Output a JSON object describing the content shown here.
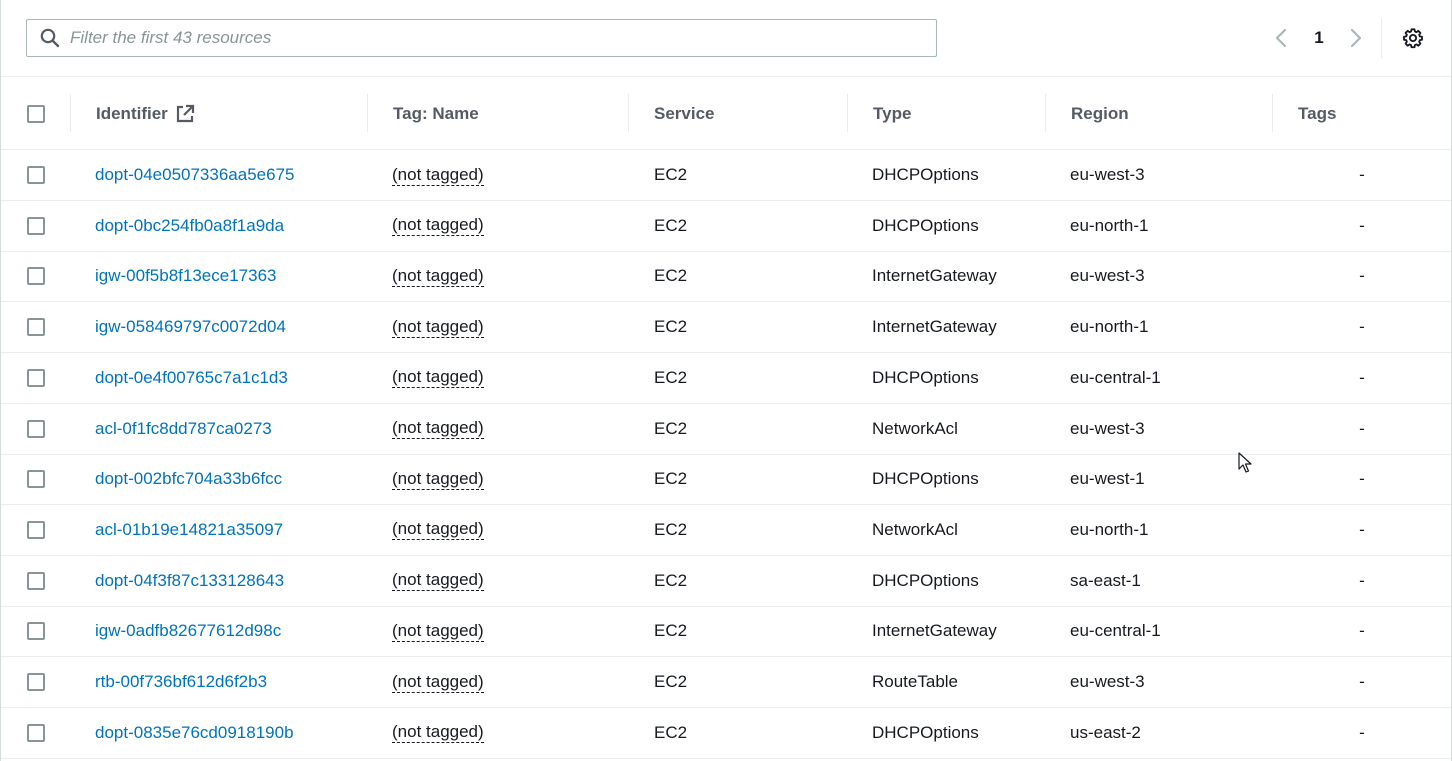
{
  "search": {
    "placeholder": "Filter the first 43 resources",
    "value": ""
  },
  "pagination": {
    "current_page": "1"
  },
  "table": {
    "columns": {
      "identifier": "Identifier",
      "tag_name": "Tag: Name",
      "service": "Service",
      "type": "Type",
      "region": "Region",
      "tags": "Tags"
    },
    "rows": [
      {
        "identifier": "dopt-04e0507336aa5e675",
        "tag_name": "(not tagged)",
        "service": "EC2",
        "type": "DHCPOptions",
        "region": "eu-west-3",
        "tags": "-"
      },
      {
        "identifier": "dopt-0bc254fb0a8f1a9da",
        "tag_name": "(not tagged)",
        "service": "EC2",
        "type": "DHCPOptions",
        "region": "eu-north-1",
        "tags": "-"
      },
      {
        "identifier": "igw-00f5b8f13ece17363",
        "tag_name": "(not tagged)",
        "service": "EC2",
        "type": "InternetGateway",
        "region": "eu-west-3",
        "tags": "-"
      },
      {
        "identifier": "igw-058469797c0072d04",
        "tag_name": "(not tagged)",
        "service": "EC2",
        "type": "InternetGateway",
        "region": "eu-north-1",
        "tags": "-"
      },
      {
        "identifier": "dopt-0e4f00765c7a1c1d3",
        "tag_name": "(not tagged)",
        "service": "EC2",
        "type": "DHCPOptions",
        "region": "eu-central-1",
        "tags": "-"
      },
      {
        "identifier": "acl-0f1fc8dd787ca0273",
        "tag_name": "(not tagged)",
        "service": "EC2",
        "type": "NetworkAcl",
        "region": "eu-west-3",
        "tags": "-"
      },
      {
        "identifier": "dopt-002bfc704a33b6fcc",
        "tag_name": "(not tagged)",
        "service": "EC2",
        "type": "DHCPOptions",
        "region": "eu-west-1",
        "tags": "-"
      },
      {
        "identifier": "acl-01b19e14821a35097",
        "tag_name": "(not tagged)",
        "service": "EC2",
        "type": "NetworkAcl",
        "region": "eu-north-1",
        "tags": "-"
      },
      {
        "identifier": "dopt-04f3f87c133128643",
        "tag_name": "(not tagged)",
        "service": "EC2",
        "type": "DHCPOptions",
        "region": "sa-east-1",
        "tags": "-"
      },
      {
        "identifier": "igw-0adfb82677612d98c",
        "tag_name": "(not tagged)",
        "service": "EC2",
        "type": "InternetGateway",
        "region": "eu-central-1",
        "tags": "-"
      },
      {
        "identifier": "rtb-00f736bf612d6f2b3",
        "tag_name": "(not tagged)",
        "service": "EC2",
        "type": "RouteTable",
        "region": "eu-west-3",
        "tags": "-"
      },
      {
        "identifier": "dopt-0835e76cd0918190b",
        "tag_name": "(not tagged)",
        "service": "EC2",
        "type": "DHCPOptions",
        "region": "us-east-2",
        "tags": "-"
      }
    ]
  },
  "icons": {
    "search": "search-icon",
    "prev": "chevron-left-icon",
    "next": "chevron-right-icon",
    "settings": "gear-icon",
    "external": "external-link-icon"
  },
  "colors": {
    "link": "#0073bb",
    "text": "#16191f",
    "header_text": "#545b64",
    "border": "#eaeded",
    "disabled": "#aab7b8"
  }
}
